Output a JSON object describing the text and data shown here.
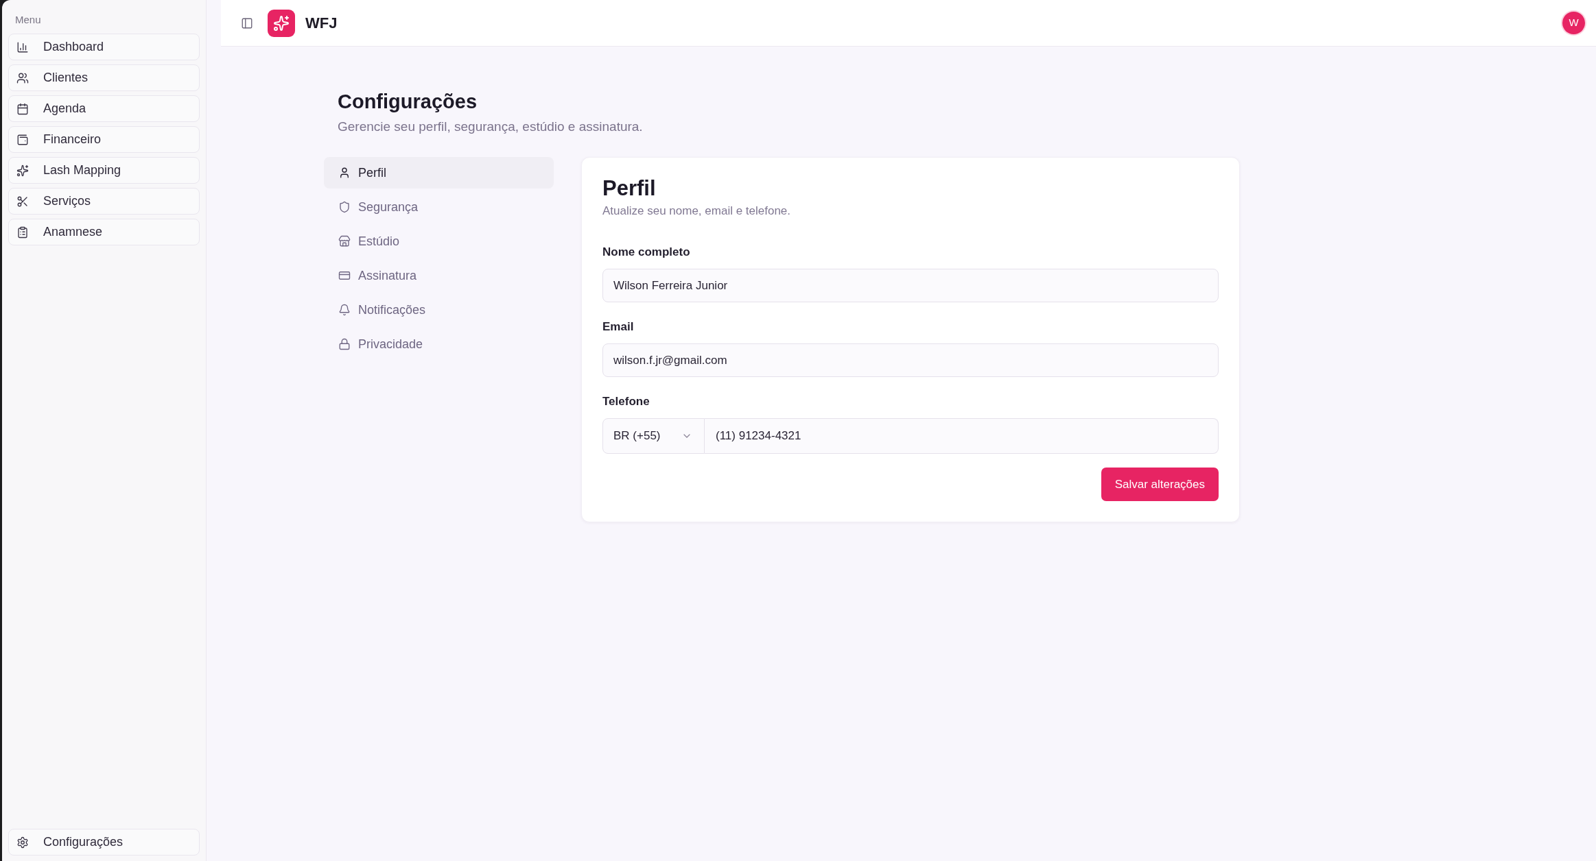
{
  "sidebar": {
    "section_label": "Menu",
    "items": [
      {
        "label": "Dashboard",
        "selected": false
      },
      {
        "label": "Clientes",
        "selected": false
      },
      {
        "label": "Agenda",
        "selected": false
      },
      {
        "label": "Financeiro",
        "selected": false
      },
      {
        "label": "Lash Mapping",
        "selected": false
      },
      {
        "label": "Serviços",
        "selected": false
      },
      {
        "label": "Anamnese",
        "selected": false
      }
    ],
    "footer_item": {
      "label": "Configurações",
      "selected": false
    }
  },
  "header": {
    "brand": "WFJ",
    "avatar_initial": "W"
  },
  "page": {
    "title": "Configurações",
    "subtitle": "Gerencie seu perfil, segurança, estúdio e assinatura."
  },
  "settings_nav": [
    {
      "label": "Perfil",
      "selected": true
    },
    {
      "label": "Segurança",
      "selected": false
    },
    {
      "label": "Estúdio",
      "selected": false
    },
    {
      "label": "Assinatura",
      "selected": false
    },
    {
      "label": "Notificações",
      "selected": false
    },
    {
      "label": "Privacidade",
      "selected": false
    }
  ],
  "profile_card": {
    "title": "Perfil",
    "subtitle": "Atualize seu nome, email e telefone.",
    "fields": [
      {
        "label": "Nome completo",
        "value": "Wilson Ferreira Junior"
      },
      {
        "label": "Email",
        "value": "wilson.f.jr@gmail.com"
      }
    ],
    "phone": {
      "label": "Telefone",
      "country": "BR (+55)",
      "value": "(11) 91234-4321"
    },
    "save_button": "Salvar alterações"
  }
}
